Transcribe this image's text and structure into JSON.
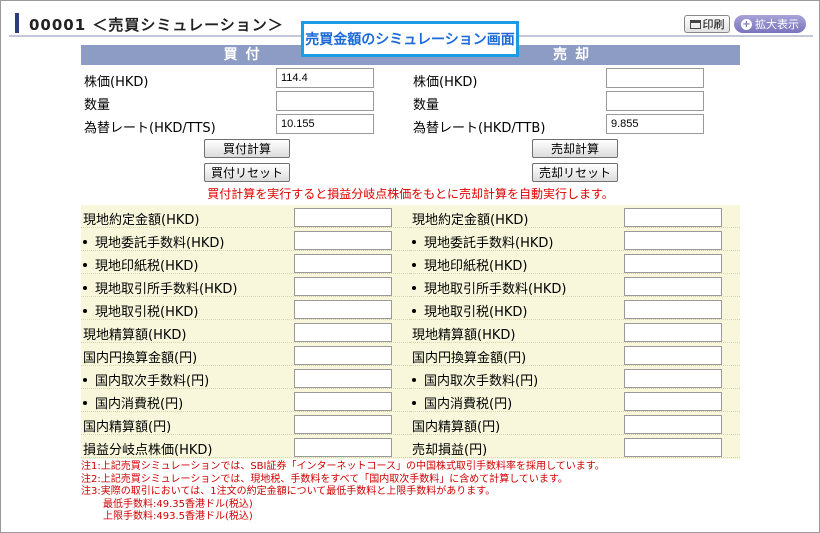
{
  "header": {
    "title": "00001 ＜売買シミュレーション＞",
    "overlay": "売買金額のシミュレーション画面",
    "print_label": "印刷",
    "expand_label": "拡大表示"
  },
  "buy": {
    "heading": "買付",
    "price_label": "株価(HKD)",
    "price_value": "114.4",
    "qty_label": "数量",
    "qty_value": "",
    "rate_label": "為替レート(HKD/TTS)",
    "rate_value": "10.155",
    "calc_button": "買付計算",
    "reset_button": "買付リセット"
  },
  "sell": {
    "heading": "売却",
    "price_label": "株価(HKD)",
    "price_value": "",
    "qty_label": "数量",
    "qty_value": "",
    "rate_label": "為替レート(HKD/TTB)",
    "rate_value": "9.855",
    "calc_button": "売却計算",
    "reset_button": "売却リセット"
  },
  "auto_message": "買付計算を実行すると損益分岐点株価をもとに売却計算を自動実行します。",
  "results_left": [
    {
      "label": "現地約定金額(HKD)",
      "bullet": false
    },
    {
      "label": "現地委託手数料(HKD)",
      "bullet": true
    },
    {
      "label": "現地印紙税(HKD)",
      "bullet": true
    },
    {
      "label": "現地取引所手数料(HKD)",
      "bullet": true
    },
    {
      "label": "現地取引税(HKD)",
      "bullet": true
    },
    {
      "label": "現地精算額(HKD)",
      "bullet": false
    },
    {
      "label": "国内円換算金額(円)",
      "bullet": false
    },
    {
      "label": "国内取次手数料(円)",
      "bullet": true
    },
    {
      "label": "国内消費税(円)",
      "bullet": true
    },
    {
      "label": "国内精算額(円)",
      "bullet": false
    },
    {
      "label": "損益分岐点株価(HKD)",
      "bullet": false
    }
  ],
  "results_right": [
    {
      "label": "現地約定金額(HKD)",
      "bullet": false
    },
    {
      "label": "現地委託手数料(HKD)",
      "bullet": true
    },
    {
      "label": "現地印紙税(HKD)",
      "bullet": true
    },
    {
      "label": "現地取引所手数料(HKD)",
      "bullet": true
    },
    {
      "label": "現地取引税(HKD)",
      "bullet": true
    },
    {
      "label": "現地精算額(HKD)",
      "bullet": false
    },
    {
      "label": "国内円換算金額(円)",
      "bullet": false
    },
    {
      "label": "国内取次手数料(円)",
      "bullet": true
    },
    {
      "label": "国内消費税(円)",
      "bullet": true
    },
    {
      "label": "国内精算額(円)",
      "bullet": false
    },
    {
      "label": "売却損益(円)",
      "bullet": false
    }
  ],
  "notes": [
    "注1:上記売買シミュレーションでは、SBI証券「インターネットコース」の中国株式取引手数料率を採用しています。",
    "注2:上記売買シミュレーションでは、現地税、手数料をすべて「国内取次手数料」に含めて計算しています。",
    "注3:実際の取引においては、1注文の約定金額について最低手数料と上限手数料があります。",
    "最低手数料:49.35香港ドル(税込)",
    "上限手数料:493.5香港ドル(税込)"
  ],
  "colors": {
    "section_header": "#8c9cc4",
    "result_bg": "#f8f7dc",
    "alert_red": "#e00000",
    "overlay_border": "#1b9ce5"
  }
}
